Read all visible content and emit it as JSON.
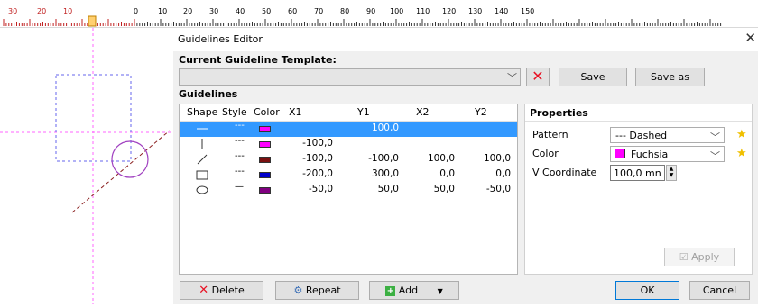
{
  "ruler": {
    "labels_red": [
      "30",
      "20",
      "10"
    ],
    "labels_black": [
      "0",
      "10",
      "20",
      "30",
      "40",
      "50",
      "60",
      "70",
      "80",
      "90",
      "100",
      "110",
      "120",
      "130",
      "140",
      "150"
    ]
  },
  "dialog": {
    "title": "Guidelines Editor",
    "close_glyph": "✕",
    "template_label": "Current Guideline Template:",
    "template_value": "",
    "delete_template_glyph": "✕",
    "save_label": "Save",
    "save_as_label": "Save as",
    "guidelines_label": "Guidelines"
  },
  "table": {
    "columns": [
      "Shape",
      "Style",
      "Color",
      "X1",
      "Y1",
      "X2",
      "Y2"
    ],
    "rows": [
      {
        "shape": "horizontal-line",
        "style": "---",
        "color": "#ff00ff",
        "x1": "",
        "y1": "100,0",
        "x2": "",
        "y2": "",
        "selected": true
      },
      {
        "shape": "vertical-line",
        "style": "---",
        "color": "#ff00ff",
        "x1": "-100,0",
        "y1": "",
        "x2": "",
        "y2": "",
        "selected": false
      },
      {
        "shape": "diagonal-line",
        "style": "---",
        "color": "#7a1010",
        "x1": "-100,0",
        "y1": "-100,0",
        "x2": "100,0",
        "y2": "100,0",
        "selected": false
      },
      {
        "shape": "rectangle",
        "style": "---",
        "color": "#0000cc",
        "x1": "-200,0",
        "y1": "300,0",
        "x2": "0,0",
        "y2": "0,0",
        "selected": false
      },
      {
        "shape": "ellipse",
        "style": "—",
        "color": "#800080",
        "x1": "-50,0",
        "y1": "50,0",
        "x2": "50,0",
        "y2": "-50,0",
        "selected": false
      }
    ]
  },
  "properties": {
    "header": "Properties",
    "pattern_label": "Pattern",
    "pattern_value": "--- Dashed",
    "color_label": "Color",
    "color_value": "Fuchsia",
    "color_swatch": "#ff00ff",
    "vcoord_label": "V Coordinate",
    "vcoord_value": "100,0 mn",
    "apply_label": "Apply"
  },
  "buttons": {
    "delete_label": "Delete",
    "repeat_label": "Repeat",
    "add_label": "Add",
    "ok_label": "OK",
    "cancel_label": "Cancel"
  },
  "colors": {
    "selection": "#3399ff",
    "guide_pink": "#ff66ff",
    "guide_blue": "#6666ee",
    "circle_purple": "#a040c0"
  }
}
